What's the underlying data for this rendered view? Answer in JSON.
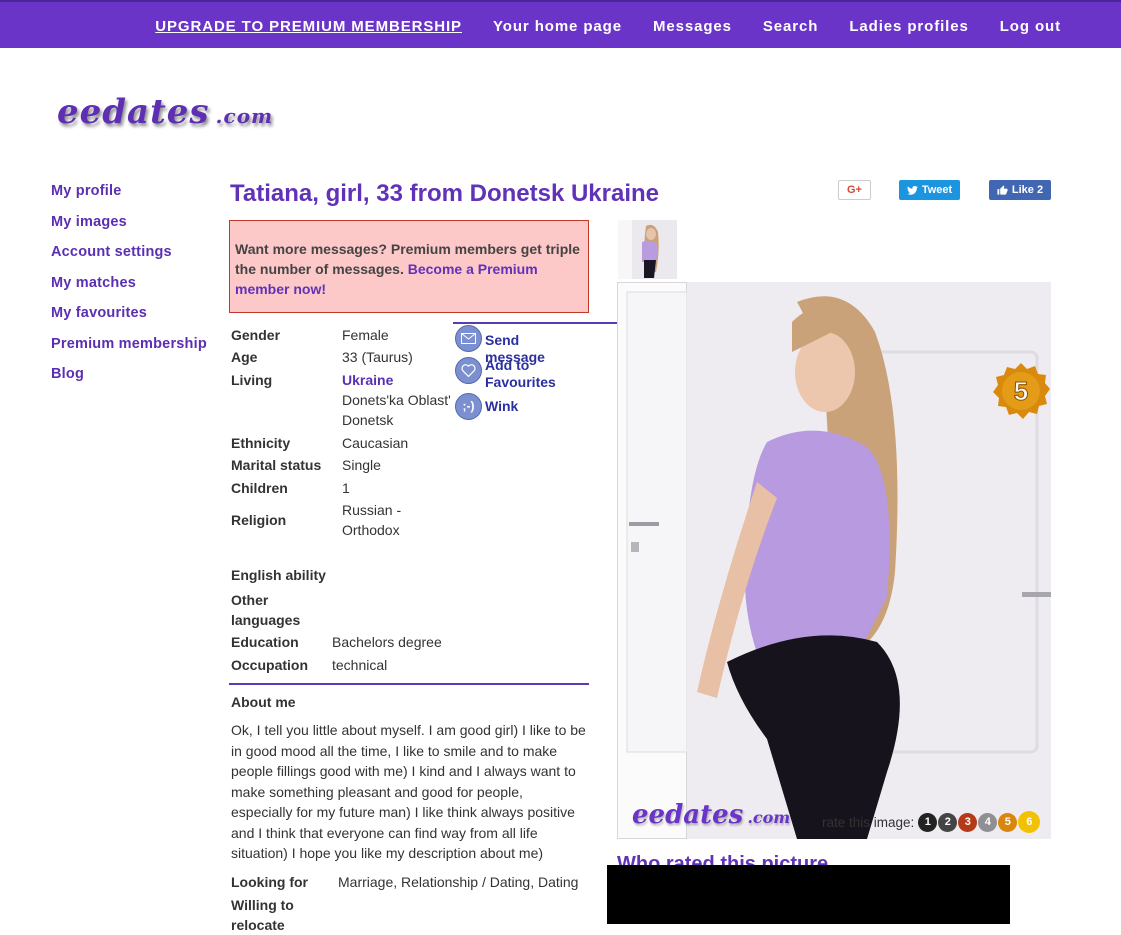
{
  "topnav": {
    "upgrade": "UPGRADE TO PREMIUM MEMBERSHIP",
    "home": "Your home page",
    "messages": "Messages",
    "search": "Search",
    "ladies": "Ladies profiles",
    "logout": "Log out"
  },
  "logo": {
    "name": "eedates",
    "tld": ".com"
  },
  "sidebar": {
    "items": [
      {
        "label": "My profile"
      },
      {
        "label": "My images"
      },
      {
        "label": "Account settings"
      },
      {
        "label": "My matches"
      },
      {
        "label": "My favourites"
      },
      {
        "label": "Premium membership"
      },
      {
        "label": "Blog"
      }
    ]
  },
  "profile": {
    "title": "Tatiana, girl, 33 from Donetsk Ukraine",
    "promo_text": "Want more messages? Premium members get triple the number of messages.",
    "promo_link": "Become a Premium member now!",
    "fields": {
      "gender_label": "Gender",
      "gender": "Female",
      "age_label": "Age",
      "age": "33 (Taurus)",
      "living_label": "Living",
      "country": "Ukraine",
      "region": "Donets'ka Oblast' Donetsk",
      "ethnicity_label": "Ethnicity",
      "ethnicity": "Caucasian",
      "marital_label": "Marital status",
      "marital": "Single",
      "children_label": "Children",
      "children": "1",
      "religion_label": "Religion",
      "religion": "Russian - Orthodox",
      "english_label": "English ability",
      "other_lang_label": "Other languages",
      "education_label": "Education",
      "education": "Bachelors degree",
      "occupation_label": "Occupation",
      "occupation": "technical",
      "looking_label": "Looking for",
      "looking": "Marriage, Relationship / Dating, Dating",
      "relocate_label": "Willing to relocate"
    },
    "about_heading": "About me",
    "about_text": "Ok, I tell you little about myself. I am good girl) I like to be in good mood all the time, I like to smile and to make people fillings good with me) I kind and I always want to make something pleasant and good for people, especially for my future man) I like think always positive and I think that everyone can find way from all life situation) I hope you like my description about me)"
  },
  "actions": {
    "send": "Send message",
    "fav": "Add to Favourites",
    "wink": "Wink",
    "wink_icon_text": ";-)"
  },
  "share": {
    "gplus": "G+",
    "tweet": "Tweet",
    "like": "Like 2"
  },
  "photo": {
    "rating_badge": "5",
    "rate_label": "rate this image:",
    "rate_buttons": [
      "1",
      "2",
      "3",
      "4",
      "5",
      "6"
    ],
    "watermark": "eedates",
    "watermark_tld": ".com"
  },
  "who_rated": "Who rated this picture",
  "colors": {
    "accent": "#6a34c9",
    "link": "#5b2fb3",
    "promo_bg": "#fcc8c8"
  }
}
